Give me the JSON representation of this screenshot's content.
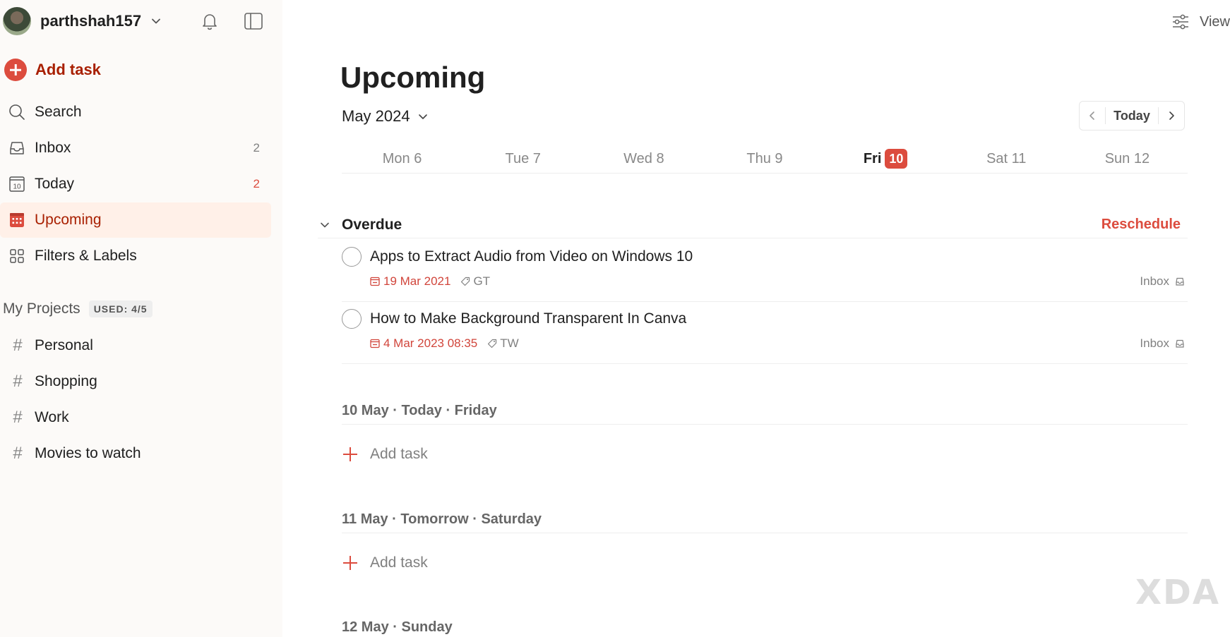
{
  "user": {
    "name": "parthshah157"
  },
  "sidebar": {
    "add_task_label": "Add task",
    "items": [
      {
        "label": "Search",
        "icon": "search-icon",
        "count": ""
      },
      {
        "label": "Inbox",
        "icon": "inbox-icon",
        "count": "2"
      },
      {
        "label": "Today",
        "icon": "calendar-today-icon",
        "count": "2",
        "calendar_day": "10"
      },
      {
        "label": "Upcoming",
        "icon": "calendar-grid-icon",
        "count": ""
      },
      {
        "label": "Filters & Labels",
        "icon": "grid-icon",
        "count": ""
      }
    ],
    "active_item": "Upcoming",
    "projects_title": "My Projects",
    "projects_usage": "USED: 4/5",
    "projects": [
      "Personal",
      "Shopping",
      "Work",
      "Movies to watch"
    ]
  },
  "main": {
    "view_label": "View",
    "title": "Upcoming",
    "month_label": "May 2024",
    "today_button": "Today",
    "week": [
      {
        "label": "Mon 6"
      },
      {
        "label": "Tue 7"
      },
      {
        "label": "Wed 8"
      },
      {
        "label": "Thu 9"
      },
      {
        "label": "Fri",
        "number": "10",
        "current": true
      },
      {
        "label": "Sat 11"
      },
      {
        "label": "Sun 12"
      }
    ],
    "overdue": {
      "title": "Overdue",
      "reschedule_label": "Reschedule",
      "tasks": [
        {
          "title": "Apps to Extract Audio from Video on Windows 10",
          "date": "19 Mar 2021",
          "tag": "GT",
          "project": "Inbox"
        },
        {
          "title": "How to Make Background Transparent In Canva",
          "date": "4 Mar 2023 08:35",
          "tag": "TW",
          "project": "Inbox"
        }
      ]
    },
    "sections": [
      {
        "title": "10 May · Today · Friday",
        "add_label": "Add task"
      },
      {
        "title": "11 May · Tomorrow · Saturday",
        "add_label": "Add task"
      },
      {
        "title": "12 May · Sunday"
      }
    ],
    "watermark": "XDA"
  },
  "colors": {
    "accent": "#dc4c3e",
    "accent_dark": "#a81f00",
    "active_bg": "#fff0e8",
    "sidebar_bg": "#fcfaf8"
  }
}
